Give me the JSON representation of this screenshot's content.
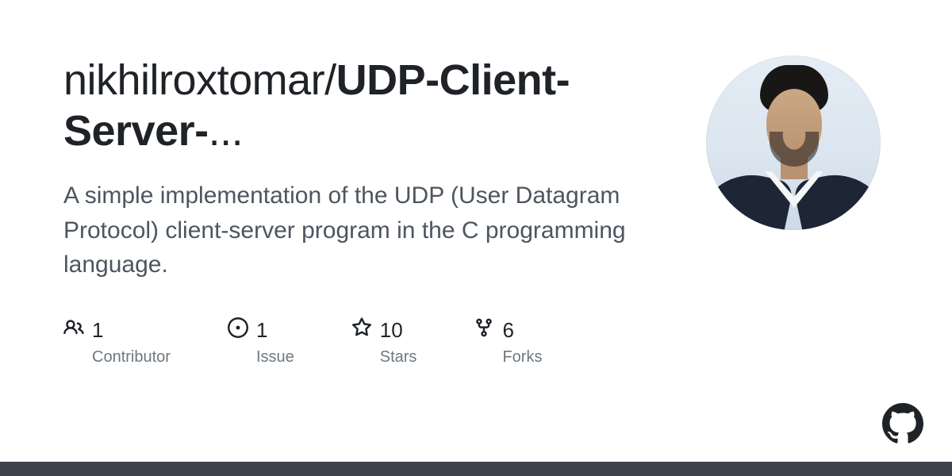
{
  "repo": {
    "owner": "nikhilroxtomar",
    "name_display": "UDP-Client-Server-",
    "ellipsis": "...",
    "description": "A simple implementation of the UDP (User Datagram Protocol) client-server program in the C programming language."
  },
  "stats": {
    "contributors": {
      "count": "1",
      "label": "Contributor"
    },
    "issues": {
      "count": "1",
      "label": "Issue"
    },
    "stars": {
      "count": "10",
      "label": "Stars"
    },
    "forks": {
      "count": "6",
      "label": "Forks"
    }
  }
}
